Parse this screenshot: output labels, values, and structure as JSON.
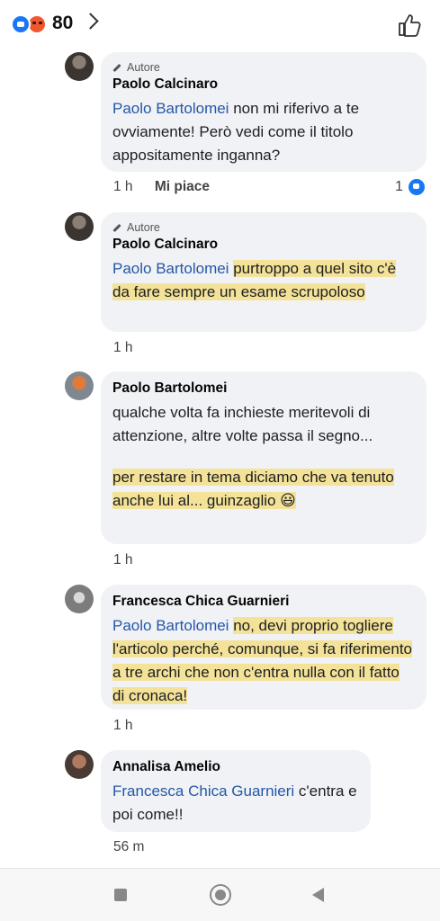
{
  "header": {
    "reaction_count": "80",
    "reaction_icons": [
      "like-icon",
      "angry-icon"
    ],
    "like_icon": "thumbs-up-outline-icon"
  },
  "colors": {
    "mention": "#2457a8",
    "highlight": "#f7d54a",
    "bubble": "#f0f2f5",
    "like_blue": "#1877f2"
  },
  "comments": [
    {
      "author_badge": "Autore",
      "author": "Paolo Calcinaro",
      "mention": "Paolo Bartolomei",
      "text": " non mi riferivo a te ovviamente! Però vedi come il titolo appositamente inganna?",
      "time": "1 h",
      "like_label": "Mi piace",
      "reaction_count": "1"
    },
    {
      "author_badge": "Autore",
      "author": "Paolo Calcinaro",
      "mention": "Paolo Bartolomei",
      "text_highlight": "purtroppo a quel sito c'è da fare sempre un esame scrupoloso",
      "time": "1 h"
    },
    {
      "author": "Paolo Bartolomei",
      "text_para1": "qualche volta fa inchieste meritevoli di attenzione, altre volte passa il segno...",
      "text_para2": "per restare in tema diciamo che va tenuto anche lui al... guinzaglio 😃",
      "time": "1 h"
    },
    {
      "author": "Francesca Chica Guarnieri",
      "mention": "Paolo Bartolomei",
      "text_highlight": "no, devi proprio togliere l'articolo perché, comunque, si fa riferimento a tre archi che non c'entra nulla con il fatto di cronaca!",
      "time": "1 h"
    },
    {
      "author": "Annalisa Amelio",
      "mention": "Francesca Chica Guarnieri",
      "text": " c'entra e poi come!!",
      "time": "56 m"
    }
  ],
  "navbar": {
    "icons": [
      "recent-apps-icon",
      "home-icon",
      "back-icon"
    ]
  }
}
